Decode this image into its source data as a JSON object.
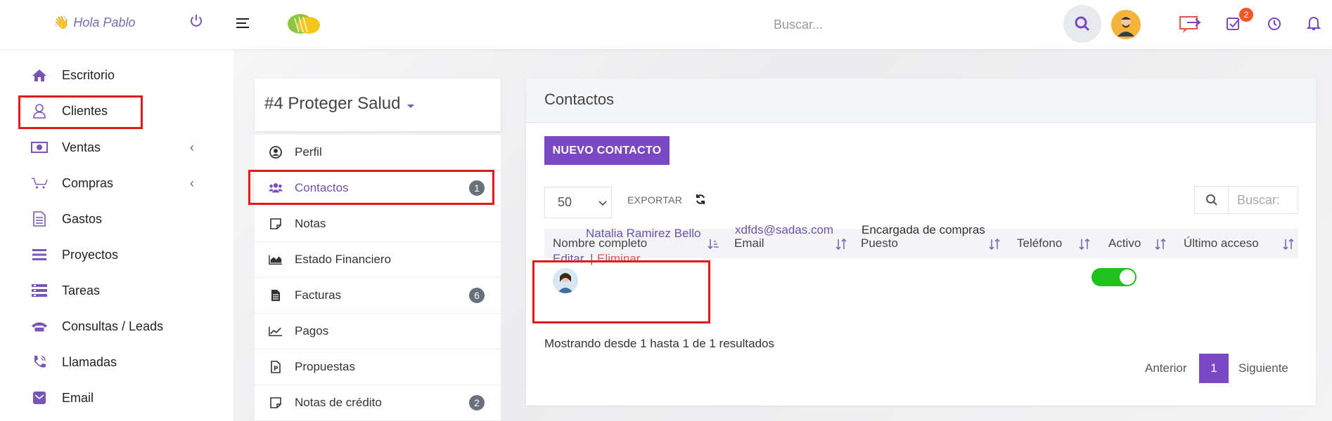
{
  "topbar": {
    "greeting": "Hola Pablo",
    "search_placeholder": "Buscar...",
    "notification_count": "2"
  },
  "sidebar": {
    "items": [
      {
        "label": "Escritorio",
        "icon": "home-icon"
      },
      {
        "label": "Clientes",
        "icon": "user-icon"
      },
      {
        "label": "Ventas",
        "icon": "money-icon"
      },
      {
        "label": "Compras",
        "icon": "cart-icon"
      },
      {
        "label": "Gastos",
        "icon": "document-icon"
      },
      {
        "label": "Proyectos",
        "icon": "bars-icon"
      },
      {
        "label": "Tareas",
        "icon": "tasks-icon"
      },
      {
        "label": "Consultas / Leads",
        "icon": "phone-icon"
      },
      {
        "label": "Llamadas",
        "icon": "call-icon"
      },
      {
        "label": "Email",
        "icon": "email-icon"
      }
    ]
  },
  "client": {
    "title": "#4 Proteger Salud",
    "menu": [
      {
        "label": "Perfil",
        "badge": ""
      },
      {
        "label": "Contactos",
        "badge": "1"
      },
      {
        "label": "Notas",
        "badge": ""
      },
      {
        "label": "Estado Financiero",
        "badge": ""
      },
      {
        "label": "Facturas",
        "badge": "6"
      },
      {
        "label": "Pagos",
        "badge": ""
      },
      {
        "label": "Propuestas",
        "badge": ""
      },
      {
        "label": "Notas de crédito",
        "badge": "2"
      }
    ]
  },
  "contacts": {
    "title": "Contactos",
    "new_button": "NUEVO CONTACTO",
    "page_size": "50",
    "export_label": "EXPORTAR",
    "search_placeholder": "Buscar:",
    "columns": [
      "Nombre completo",
      "Email",
      "Puesto",
      "Teléfono",
      "Activo",
      "Último acceso"
    ],
    "rows": [
      {
        "name": "Natalia Ramirez Bello",
        "email": "xdfds@sadas.com",
        "position": "Encargada de compras",
        "phone": "",
        "active": true,
        "last_access": "",
        "edit": "Editar",
        "separator": "|",
        "delete": "Eliminar"
      }
    ],
    "showing": "Mostrando desde 1 hasta 1 de 1 resultados",
    "pager": {
      "prev": "Anterior",
      "current": "1",
      "next": "Siguiente"
    }
  },
  "colors": {
    "accent": "#7a48c2",
    "highlight": "#e01b1b",
    "toggle_on": "#1ec21e"
  }
}
